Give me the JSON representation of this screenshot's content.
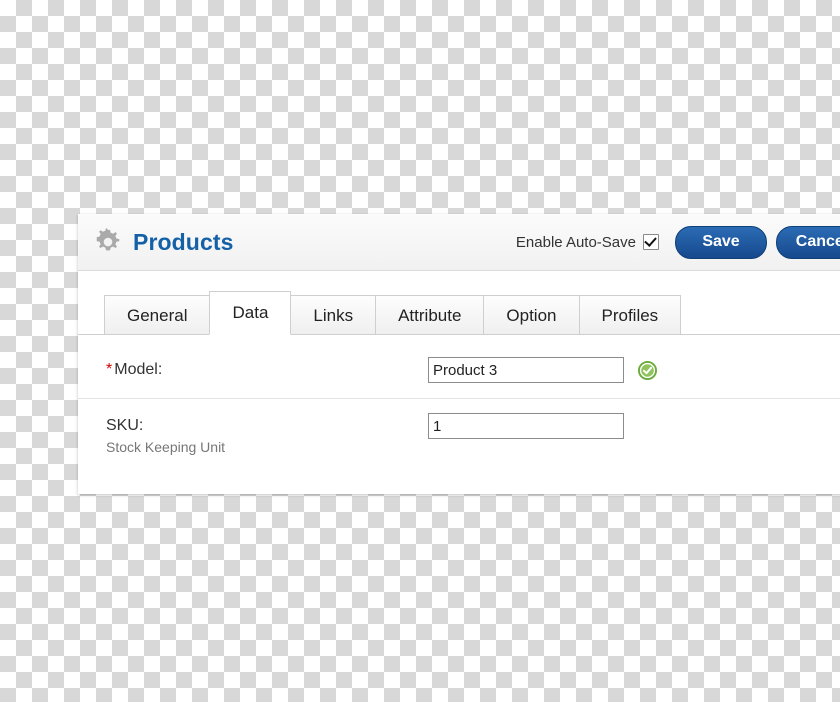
{
  "header": {
    "icon": "gear-icon",
    "title": "Products",
    "autosave_label": "Enable Auto-Save",
    "autosave_checked": "true",
    "save_label": "Save",
    "cancel_label": "Cancel"
  },
  "tabs": [
    {
      "label": "General",
      "active": "false"
    },
    {
      "label": "Data",
      "active": "true"
    },
    {
      "label": "Links",
      "active": "false"
    },
    {
      "label": "Attribute",
      "active": "false"
    },
    {
      "label": "Option",
      "active": "false"
    },
    {
      "label": "Profiles",
      "active": "false"
    }
  ],
  "form": {
    "rows": [
      {
        "required": "*",
        "label": "Model:",
        "help": "",
        "value": "Product 3",
        "status_icon": "valid-check-icon"
      },
      {
        "required": "",
        "label": "SKU:",
        "help": "Stock Keeping Unit",
        "value": "1",
        "status_icon": ""
      }
    ]
  },
  "colors": {
    "title_blue": "#1461a8",
    "button_blue": "#16488c",
    "required_red": "#d00000",
    "valid_green": "#6aab3c"
  }
}
